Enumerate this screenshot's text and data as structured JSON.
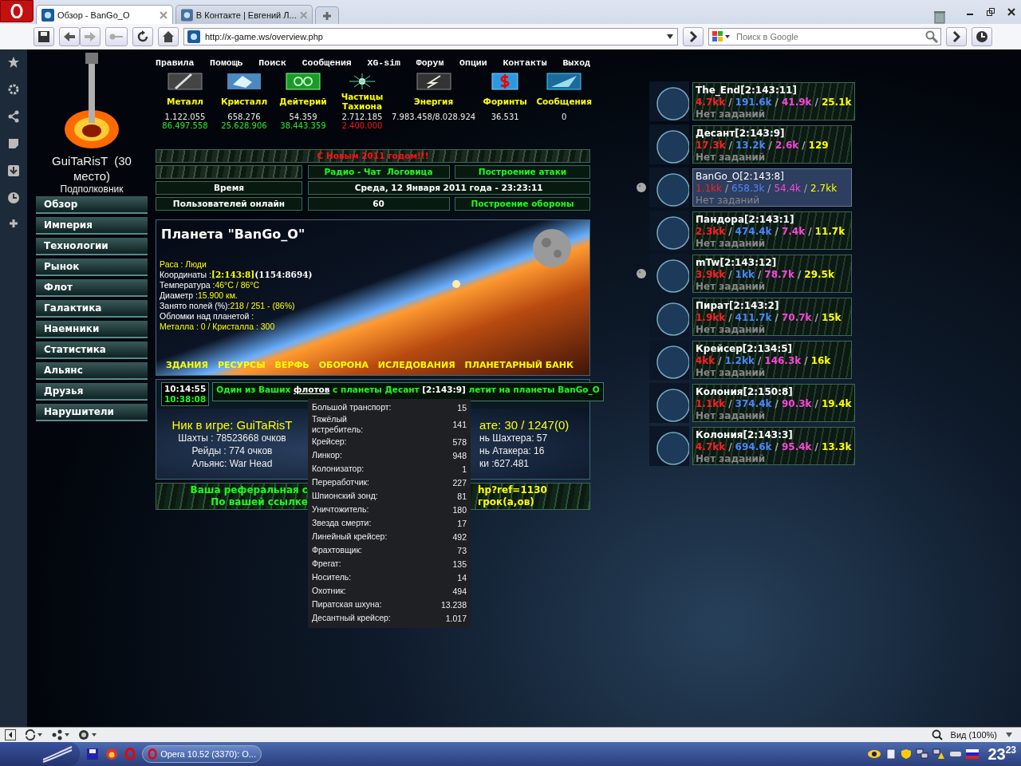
{
  "browser": {
    "tabs": [
      {
        "title": "Обзор - BanGo_O",
        "selected": true
      },
      {
        "title": "В Контакте | Евгений Л...",
        "selected": false
      }
    ],
    "address": "http://x-game.ws/overview.php",
    "search": {
      "placeholder": "Поиск в Google"
    }
  },
  "sidebar": {
    "player": "GuiTaRisT  (30 место)",
    "rank": "Подполковник",
    "menu": [
      "Обзор",
      "Империя",
      "Технологии",
      "Рынок",
      "Флот",
      "Галактика",
      "Наемники",
      "Статистика",
      "Альянс",
      "Друзья",
      "Нарушители"
    ]
  },
  "nav": [
    "Правила",
    "Помощь",
    "Поиск",
    "Сообщения",
    "XG-sim",
    "Форум",
    "Опции",
    "Контакты",
    "Выход"
  ],
  "resources": [
    {
      "kind": "metal",
      "name": "Металл",
      "amount": "1.122.055",
      "income": "86.497.558",
      "color": "#22ee22"
    },
    {
      "kind": "crystal",
      "name": "Кристалл",
      "amount": "658.276",
      "income": "25.628.906",
      "color": "#22ee22"
    },
    {
      "kind": "deuterium",
      "name": "Дейтерий",
      "amount": "54.359",
      "income": "38.443.359",
      "color": "#22ee22"
    },
    {
      "kind": "tachyon",
      "name": "Частицы Тахиона",
      "amount": "2.712.185",
      "income": "2.400.000",
      "color": "#ff1111"
    },
    {
      "kind": "energy",
      "name": "Энергия",
      "amount": "7.983.458/8.028.924"
    },
    {
      "kind": "money",
      "name": "Форинты",
      "amount": "36.531"
    },
    {
      "kind": "messages",
      "name": "Сообщения",
      "amount": "0"
    }
  ],
  "info": {
    "greeting": "С Новым 2011 годом!!!",
    "links": [
      "Радио - Чат  Логовица",
      "Построение атаки"
    ],
    "time_label": "Время",
    "time_value": "Среда, 12 Января 2011 года - 23:23:11",
    "online_label": "Пользователей онлайн",
    "online_value": "60",
    "online_link": "Построение обороны"
  },
  "planet": {
    "title": "Планета \"BanGo_O\"",
    "details": [
      {
        "value": "Раса : Люди"
      },
      {
        "label": "Координаты :",
        "value": "[2:143:8]",
        "extra": "(1154:8694)"
      },
      {
        "label": "Температура :",
        "value": "46°C / 86°C"
      },
      {
        "label": "Диаметр :",
        "value": "15.900 км."
      },
      {
        "label": "Занято полей (%):",
        "value": "218 / 251  -  (86%)"
      },
      {
        "label": "Обломки над планетой :"
      },
      {
        "value": "Металла : 0 / Кристалла : 300"
      }
    ],
    "links": [
      "ЗДАНИЯ",
      "РЕСУРСЫ",
      "ВЕРФЬ",
      "ОБОРОНА",
      "ИСЛЕДОВАНИЯ",
      "ПЛАНЕТАРНЫЙ БАНК"
    ]
  },
  "fleet_event": {
    "times": [
      "10:14:55",
      "10:38:08"
    ],
    "message": [
      {
        "kind": "text",
        "text": "Один из Ваших"
      },
      {
        "kind": "link",
        "text": "флотов"
      },
      {
        "kind": "text",
        "text": "с планеты Десант"
      },
      {
        "kind": "coords",
        "text": "[2:143:9]"
      },
      {
        "kind": "text",
        "text": "летит на планеты BanGo_O"
      }
    ]
  },
  "stats": {
    "left": [
      "Ник в игре: GuiTaRisT",
      "Шахты : 78523668 очков",
      "Рейды : 774 очков",
      "Альянс: War Head"
    ],
    "right": [
      "ате: 30 / 1247(0)",
      "нь Шахтера: 57",
      "нь Атакера: 16",
      "ки :627.481"
    ]
  },
  "referral": {
    "left": [
      "Ваша реферальная с",
      "По вашей ссылке"
    ],
    "right": [
      "hp?ref=1130",
      "грок(а,ов)"
    ]
  },
  "fleet_tooltip": [
    {
      "ship": "Большой транспорт:",
      "count": "15"
    },
    {
      "ship": "Тяжёлый истребитель:",
      "count": "141"
    },
    {
      "ship": "Крейсер:",
      "count": "578"
    },
    {
      "ship": "Линкор:",
      "count": "948"
    },
    {
      "ship": "Колонизатор:",
      "count": "1"
    },
    {
      "ship": "Переработчик:",
      "count": "227"
    },
    {
      "ship": "Шпионский зонд:",
      "count": "81"
    },
    {
      "ship": "Уничтожитель:",
      "count": "180"
    },
    {
      "ship": "Звезда смерти:",
      "count": "17"
    },
    {
      "ship": "Линейный крейсер:",
      "count": "492"
    },
    {
      "ship": "Фрахтовщик:",
      "count": "73"
    },
    {
      "ship": "Фрегат:",
      "count": "135"
    },
    {
      "ship": "Носитель:",
      "count": "14"
    },
    {
      "ship": "Охотник:",
      "count": "494"
    },
    {
      "ship": "Пиратская шхуна:",
      "count": "13.238"
    },
    {
      "ship": "Десантный крейсер:",
      "count": "1.017"
    }
  ],
  "planets": [
    {
      "name": "The_End[2:143:11]",
      "values": [
        "4.7kk",
        "191.6k",
        "41.9k",
        "25.1k"
      ],
      "dividers": [
        "/",
        "/",
        "/"
      ],
      "task": "Нет заданий",
      "selected": false,
      "moon": false
    },
    {
      "name": "Десант[2:143:9]",
      "values": [
        "17.3k",
        "13.2k",
        "2.6k",
        "129"
      ],
      "dividers": [
        "/",
        "/",
        "/"
      ],
      "task": "Нет заданий",
      "selected": false,
      "moon": false
    },
    {
      "name": "BanGo_O[2:143:8]",
      "values": [
        "1.1kk",
        "658.3k",
        "54.4k",
        "2.7kk"
      ],
      "dividers": [
        "/",
        "/",
        "/"
      ],
      "task": "Нет заданий",
      "selected": true,
      "moon": true
    },
    {
      "name": "Пандора[2:143:1]",
      "values": [
        "2.3kk",
        "474.4k",
        "7.4k",
        "11.7k"
      ],
      "dividers": [
        "/",
        "/",
        "/"
      ],
      "task": "Нет заданий",
      "selected": false,
      "moon": false
    },
    {
      "name": "mTw[2:143:12]",
      "values": [
        "3.9kk",
        "1kk",
        "78.7k",
        "29.5k"
      ],
      "dividers": [
        "/",
        "/",
        "/"
      ],
      "task": "Нет заданий",
      "selected": false,
      "moon": true
    },
    {
      "name": "Пират[2:143:2]",
      "values": [
        "1.9kk",
        "411.7k",
        "70.7k",
        "15k"
      ],
      "dividers": [
        "/",
        "/",
        "/"
      ],
      "task": "Нет заданий",
      "selected": false,
      "moon": false
    },
    {
      "name": "Крейсер[2:134:5]",
      "values": [
        "4kk",
        "1.2kk",
        "146.3k",
        "16k"
      ],
      "dividers": [
        "/",
        "/",
        "/"
      ],
      "task": "Нет заданий",
      "selected": false,
      "moon": false
    },
    {
      "name": "Колония[2:150:8]",
      "values": [
        "1.1kk",
        "374.4k",
        "90.3k",
        "19.4k"
      ],
      "dividers": [
        "/",
        "/",
        "/"
      ],
      "task": "Нет заданий",
      "selected": false,
      "moon": false
    },
    {
      "name": "Колония[2:143:3]",
      "values": [
        "4.7kk",
        "694.6k",
        "95.4k",
        "13.3k"
      ],
      "dividers": [
        "/",
        "/",
        "/"
      ],
      "task": "Нет заданий",
      "selected": false,
      "moon": false
    }
  ],
  "status_bar": {
    "zoom": "Вид (100%)"
  },
  "taskbar": {
    "task": "Opera 10.52 (3370): О...",
    "clock_hours": "23",
    "clock_minutes": "23"
  }
}
